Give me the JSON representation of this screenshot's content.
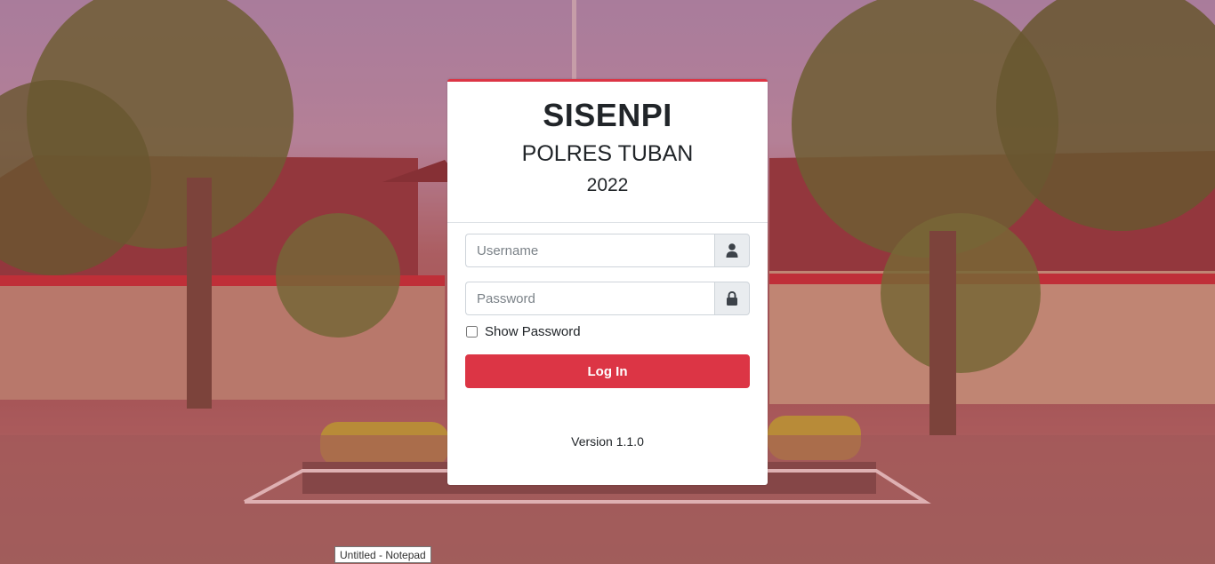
{
  "login": {
    "title": "SISENPI",
    "subtitle": "POLRES TUBAN",
    "year": "2022",
    "username_placeholder": "Username",
    "password_placeholder": "Password",
    "show_password_label": "Show Password",
    "login_button": "Log In",
    "version": "Version 1.1.0",
    "accent_color": "#dc3545"
  },
  "icons": {
    "username_icon": "user-icon",
    "password_icon": "lock-icon"
  },
  "taskbar_tooltip": {
    "text": "Untitled - Notepad"
  }
}
